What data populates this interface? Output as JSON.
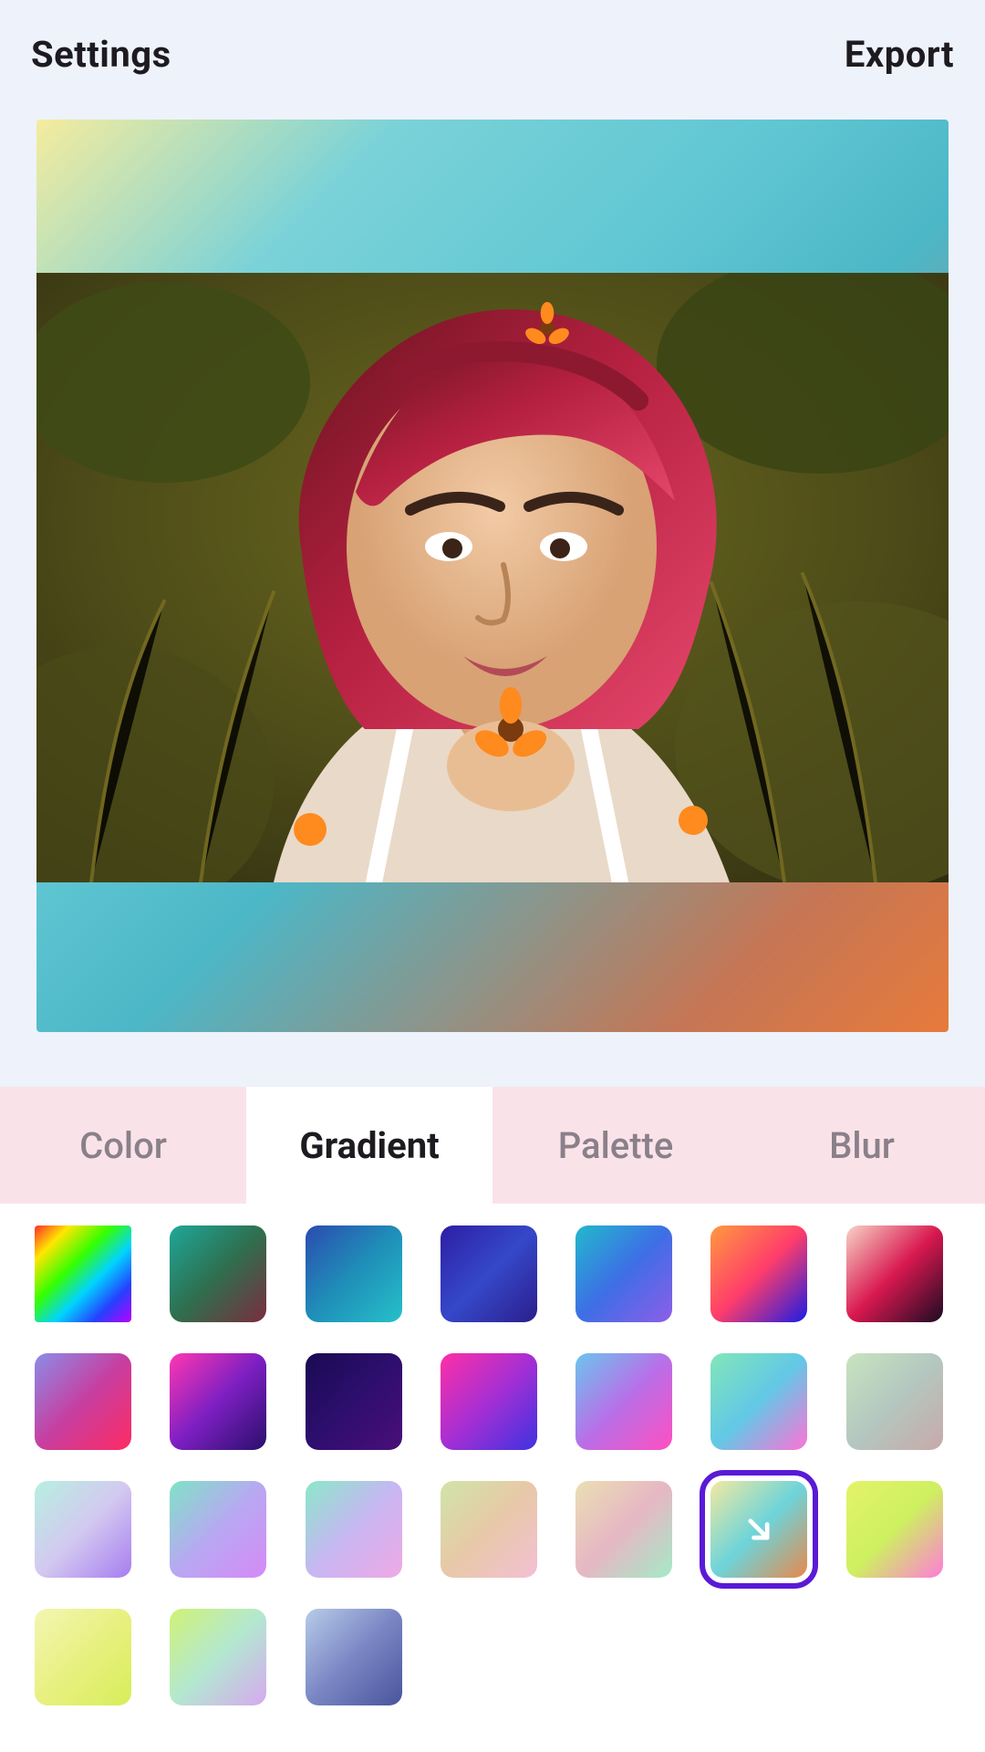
{
  "header": {
    "settings_label": "Settings",
    "export_label": "Export"
  },
  "tabs": [
    {
      "id": "color",
      "label": "Color",
      "active": false
    },
    {
      "id": "gradient",
      "label": "Gradient",
      "active": true
    },
    {
      "id": "palette",
      "label": "Palette",
      "active": false
    },
    {
      "id": "blur",
      "label": "Blur",
      "active": false
    }
  ],
  "canvas": {
    "applied_gradient_index": 19,
    "gradient_css": "linear-gradient(135deg,#f5ec9e 0%,#7ad2d8 25%,#4cb7c7 55%,#e77a3b 100%)"
  },
  "swatches": {
    "selected_index": 19,
    "items": [
      {
        "id": "rainbow"
      },
      {
        "id": "teal-maroon"
      },
      {
        "id": "navy-teal"
      },
      {
        "id": "indigo"
      },
      {
        "id": "sky-violet"
      },
      {
        "id": "sunset-blue"
      },
      {
        "id": "peach-crimson"
      },
      {
        "id": "lilac-pink"
      },
      {
        "id": "magenta-purple"
      },
      {
        "id": "deep-purple"
      },
      {
        "id": "fuchsia-blue"
      },
      {
        "id": "aqua-magenta"
      },
      {
        "id": "mint-pink"
      },
      {
        "id": "sage-rose"
      },
      {
        "id": "mint-violet"
      },
      {
        "id": "seafoam-lilac"
      },
      {
        "id": "aqua-lilac"
      },
      {
        "id": "olive-blush"
      },
      {
        "id": "cream-mint"
      },
      {
        "id": "butter-teal-orange"
      },
      {
        "id": "lime-pink"
      },
      {
        "id": "pale-lime"
      },
      {
        "id": "lime-mint-violet"
      },
      {
        "id": "slate-blue"
      }
    ]
  },
  "icons": {
    "direction_arrow": "arrow-down-right-icon"
  }
}
